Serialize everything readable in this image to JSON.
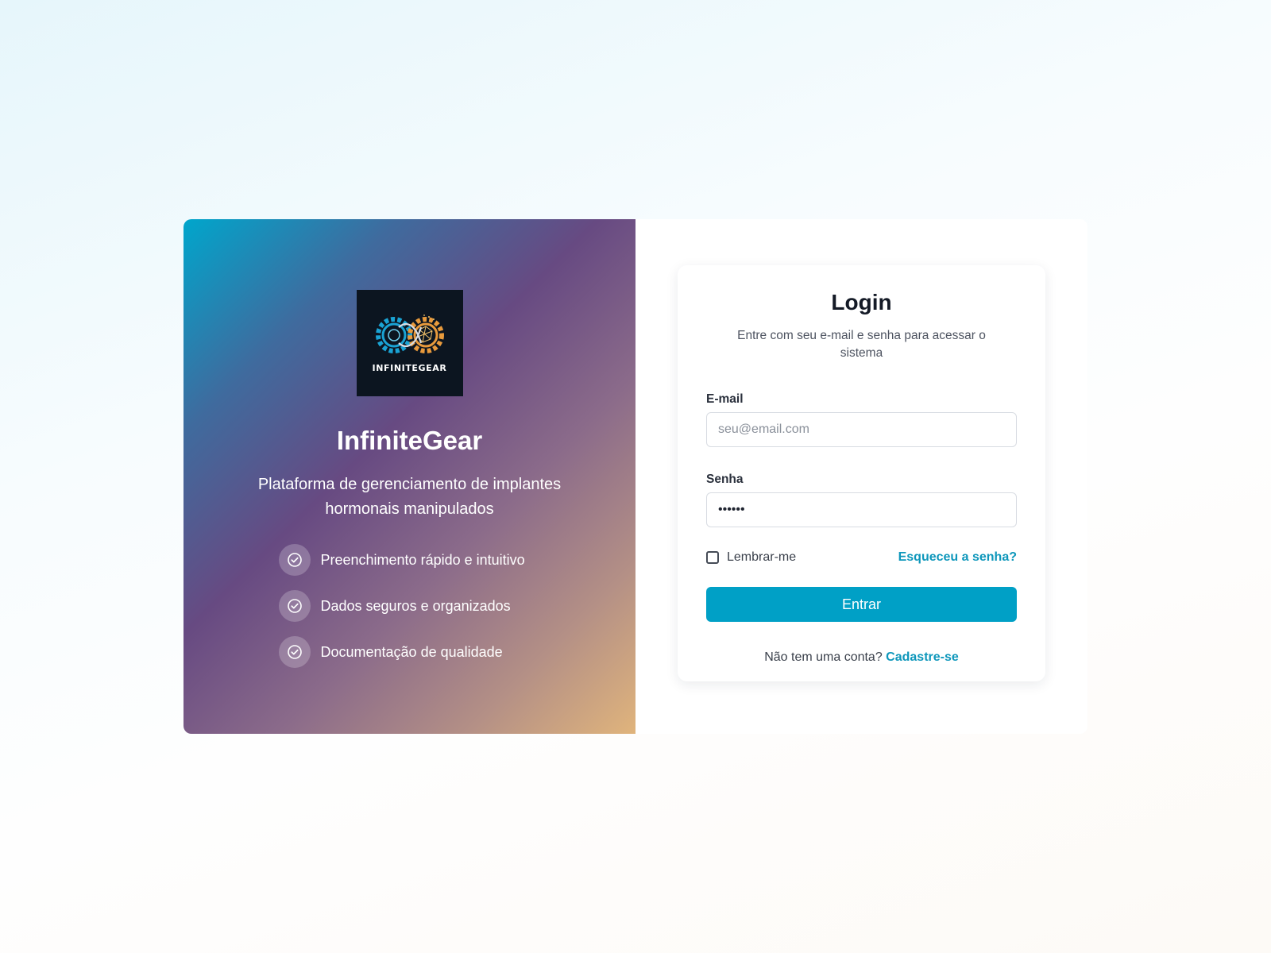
{
  "brand": {
    "logo_text": "INFINITEGEAR",
    "name": "InfiniteGear",
    "tagline": "Plataforma de gerenciamento de implantes hormonais manipulados",
    "features": [
      {
        "label": "Preenchimento rápido e intuitivo",
        "icon": "check-circle-icon"
      },
      {
        "label": "Dados seguros e organizados",
        "icon": "check-circle-icon"
      },
      {
        "label": "Documentação de qualidade",
        "icon": "check-circle-icon"
      }
    ],
    "gradient_colors": [
      "#00a6cc",
      "#674a82",
      "#e0b47c"
    ]
  },
  "login": {
    "title": "Login",
    "subtitle": "Entre com seu e-mail e senha para acessar o sistema",
    "email": {
      "label": "E-mail",
      "placeholder": "seu@email.com",
      "value": ""
    },
    "password": {
      "label": "Senha",
      "value": "••••••"
    },
    "remember_label": "Lembrar-me",
    "remember_checked": false,
    "forgot_label": "Esqueceu a senha?",
    "submit_label": "Entrar",
    "signup_prompt": "Não tem uma conta?",
    "signup_label": "Cadastre-se"
  },
  "colors": {
    "accent": "#00a0c6",
    "link": "#0e97bb"
  }
}
